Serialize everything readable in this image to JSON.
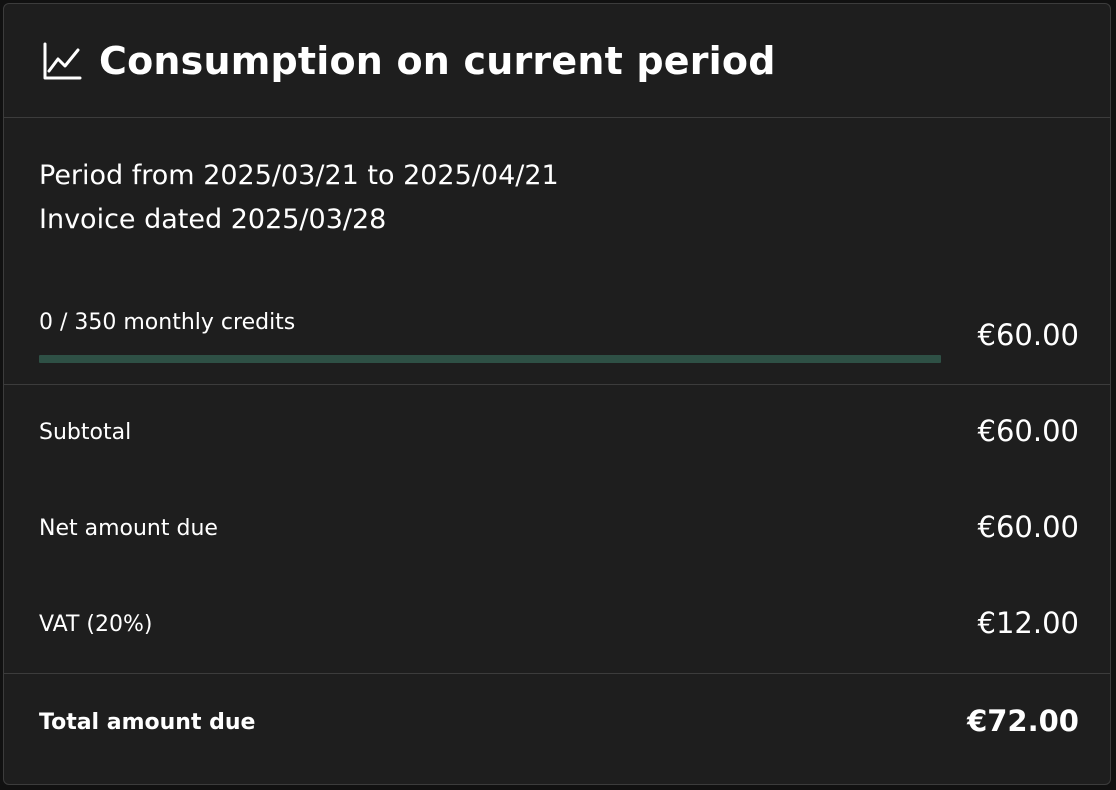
{
  "header": {
    "icon": "line-chart-icon",
    "title": "Consumption on current period"
  },
  "period": {
    "range": "Period from 2025/03/21 to 2025/04/21",
    "invoice": "Invoice dated 2025/03/28"
  },
  "credits": {
    "label": "0 / 350 monthly credits",
    "used": 0,
    "total": 350,
    "amount": "€60.00",
    "bar_color": "#2e5045"
  },
  "summary": {
    "subtotal_label": "Subtotal",
    "subtotal_value": "€60.00",
    "net_label": "Net amount due",
    "net_value": "€60.00",
    "vat_label": "VAT (20%)",
    "vat_value": "€12.00",
    "total_label": "Total amount due",
    "total_value": "€72.00"
  }
}
